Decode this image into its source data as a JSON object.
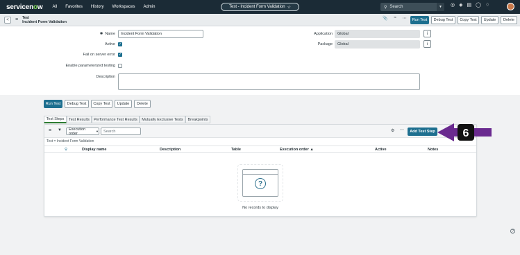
{
  "nav": {
    "logo_a": "servicen",
    "logo_o": "o",
    "logo_b": "w",
    "menu": [
      "All",
      "Favorites",
      "History",
      "Workspaces",
      "Admin"
    ],
    "pill_title": "Test - Incident Form Validation",
    "pill_star": "☆",
    "search_placeholder": "Search"
  },
  "header": {
    "back": "<",
    "table": "Test",
    "record": "Incident Form Validation",
    "buttons": {
      "run": "Run Test",
      "debug": "Debug Test",
      "copy": "Copy Test",
      "update": "Update",
      "delete": "Delete"
    }
  },
  "form": {
    "name_label": "Name",
    "name_value": "Incident Form Validation",
    "active_label": "Active",
    "fail_label": "Fail on server error",
    "param_label": "Enable parameterized testing",
    "desc_label": "Description",
    "application_label": "Application",
    "application_value": "Global",
    "package_label": "Package",
    "package_value": "Global",
    "check": "✓",
    "info": "i"
  },
  "actions": {
    "run": "Run Test",
    "debug": "Debug Test",
    "copy": "Copy Test",
    "update": "Update",
    "delete": "Delete"
  },
  "tabs": [
    "Test Steps",
    "Test Results",
    "Performance Test Results",
    "Mutually Exclusive Tests",
    "Breakpoints"
  ],
  "list": {
    "sort_select": "Execution order",
    "search_placeholder": "Search",
    "add_button": "Add Test Step",
    "filter": "Test = Incident Form Validation",
    "columns": [
      "Display name",
      "Description",
      "Table",
      "Execution order ▲",
      "Active",
      "Notes"
    ],
    "empty": "No records to display",
    "question": "?"
  },
  "callout": {
    "number": "6",
    "fill": "#6a2a8f",
    "badge": "#111111"
  },
  "colors": {
    "nav": "#1b2b36",
    "primary": "#1d6f8f",
    "tab_active": "#2e7d32"
  }
}
